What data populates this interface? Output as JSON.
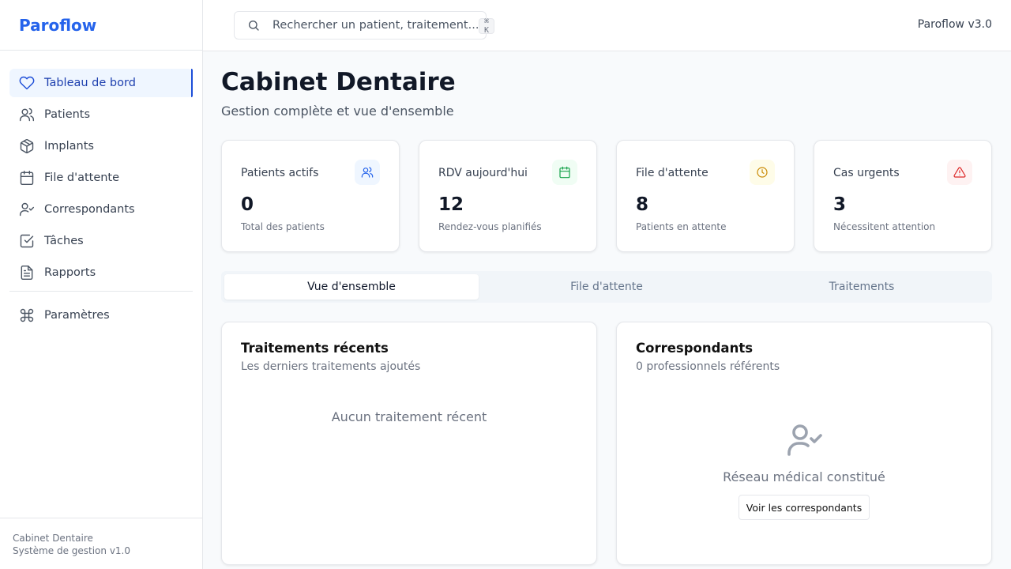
{
  "brand": "Paroflow",
  "nav": {
    "items": [
      {
        "label": "Tableau de bord",
        "icon": "heart-icon"
      },
      {
        "label": "Patients",
        "icon": "users-icon"
      },
      {
        "label": "Implants",
        "icon": "package-icon"
      },
      {
        "label": "File d'attente",
        "icon": "calendar-icon"
      },
      {
        "label": "Correspondants",
        "icon": "user-check-icon"
      },
      {
        "label": "Tâches",
        "icon": "check-square-icon"
      },
      {
        "label": "Rapports",
        "icon": "file-text-icon"
      }
    ],
    "settings": {
      "label": "Paramètres",
      "icon": "command-icon"
    },
    "active_index": 0
  },
  "footer": {
    "line1": "Cabinet Dentaire",
    "line2": "Système de gestion v1.0"
  },
  "header": {
    "search_placeholder": "Rechercher un patient, traitement...",
    "shortcut": "⌘ K",
    "version": "Paroflow v3.0"
  },
  "page": {
    "title": "Cabinet Dentaire",
    "subtitle": "Gestion complète et vue d'ensemble"
  },
  "stats": [
    {
      "label": "Patients actifs",
      "value": "0",
      "desc": "Total des patients",
      "icon": "users-icon",
      "color": "#2563eb",
      "bg": "#eff6ff"
    },
    {
      "label": "RDV aujourd'hui",
      "value": "12",
      "desc": "Rendez-vous planifiés",
      "icon": "calendar-icon",
      "color": "#16a34a",
      "bg": "#f0fdf4"
    },
    {
      "label": "File d'attente",
      "value": "8",
      "desc": "Patients en attente",
      "icon": "clock-icon",
      "color": "#ca8a04",
      "bg": "#fefce8"
    },
    {
      "label": "Cas urgents",
      "value": "3",
      "desc": "Nécessitent attention",
      "icon": "alert-triangle-icon",
      "color": "#dc2626",
      "bg": "#fef2f2"
    }
  ],
  "tabs": [
    "Vue d'ensemble",
    "File d'attente",
    "Traitements"
  ],
  "panels": {
    "treatments": {
      "title": "Traitements récents",
      "subtitle": "Les derniers traitements ajoutés",
      "empty": "Aucun traitement récent"
    },
    "correspondents": {
      "title": "Correspondants",
      "subtitle": "0 professionnels référents",
      "empty": "Réseau médical constitué",
      "button": "Voir les correspondants"
    }
  },
  "colors": {
    "accent": "#2563eb",
    "active_bg": "#eff6ff",
    "active_text": "#1e40af"
  }
}
